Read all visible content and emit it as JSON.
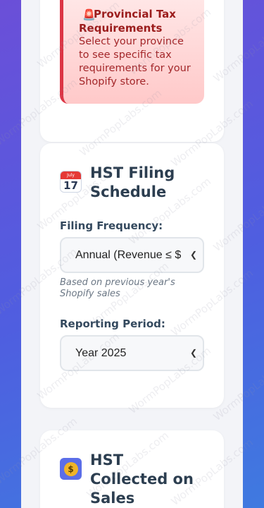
{
  "province_alert": {
    "icon": "siren-icon",
    "title": "Provincial Tax Requirements",
    "body": "Select your province to see specific tax requirements for your Shopify store."
  },
  "hst_filing_schedule": {
    "icon": "calendar-icon",
    "calendar_month": "July",
    "calendar_day": "17",
    "title": "HST Filing Schedule",
    "frequency_label": "Filing Frequency:",
    "frequency_selected": "Annual (Revenue ≤ $",
    "frequency_hint": "Based on previous year's Shopify sales",
    "period_label": "Reporting Period:",
    "period_selected": "Year 2025"
  },
  "hst_collected": {
    "icon": "money-bag-icon",
    "title": "HST Collected on Sales"
  },
  "watermark": "WormPopLabs.com",
  "colors": {
    "alert_border": "#dc3545",
    "alert_text": "#9b1c1c",
    "heading": "#2c3e50"
  }
}
